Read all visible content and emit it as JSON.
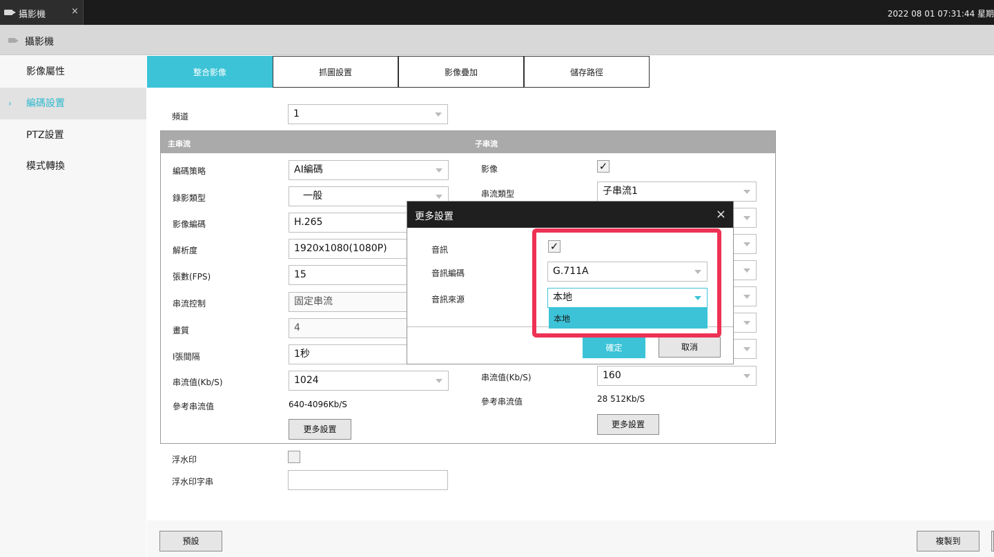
{
  "window": {
    "tab_title": "攝影機",
    "tab_close": "×",
    "datetime": "2022 08 01 07:31:44 星期"
  },
  "header": {
    "title": "攝影機"
  },
  "sidebar": {
    "items": [
      {
        "label": "影像屬性"
      },
      {
        "label": "編碼設置",
        "active": true,
        "chevron": "›"
      },
      {
        "label": "PTZ設置"
      },
      {
        "label": "模式轉換"
      }
    ]
  },
  "tabs": [
    {
      "label": "整合影像",
      "active": true
    },
    {
      "label": "抓圖設置"
    },
    {
      "label": "影像疊加"
    },
    {
      "label": "儲存路徑"
    }
  ],
  "channel": {
    "label": "頻道",
    "value": "1"
  },
  "main_stream": {
    "title": "主串流",
    "fields": {
      "encoding_strategy": {
        "label": "編碼策略",
        "value": "AI編碼"
      },
      "record_type": {
        "label": "錄影類型",
        "value": "一般"
      },
      "video_encoding": {
        "label": "影像編碼",
        "value": "H.265"
      },
      "resolution": {
        "label": "解析度",
        "value": "1920x1080(1080P)"
      },
      "fps": {
        "label": "張數(FPS)",
        "value": "15"
      },
      "bitrate_control": {
        "label": "串流控制",
        "value": "固定串流"
      },
      "quality": {
        "label": "畫質",
        "value": "4"
      },
      "iframe_interval": {
        "label": "I張間隔",
        "value": "1秒"
      },
      "bitrate": {
        "label": "串流值(Kb/S)",
        "value": "1024"
      },
      "ref_bitrate": {
        "label": "參考串流值",
        "value": "640-4096Kb/S"
      }
    },
    "more_button": "更多設置"
  },
  "sub_stream": {
    "title": "子串流",
    "video": {
      "label": "影像",
      "checked": true,
      "mark": "✓"
    },
    "stream_type": {
      "label": "串流類型",
      "value": "子串流1"
    },
    "bitrate": {
      "label": "串流值(Kb/S)",
      "value": "160"
    },
    "ref_bitrate": {
      "label": "參考串流值",
      "value": "28 512Kb/S"
    },
    "more_button": "更多設置"
  },
  "watermark": {
    "label": "浮水印",
    "checked": false
  },
  "watermark_text": {
    "label": "浮水印字串",
    "value": ""
  },
  "bottom": {
    "default_button": "預設",
    "copy_button": "複製到"
  },
  "modal": {
    "title": "更多設置",
    "close": "×",
    "audio": {
      "label": "音訊",
      "checked": true,
      "mark": "✓"
    },
    "audio_encoding": {
      "label": "音訊編碼",
      "value": "G.711A"
    },
    "audio_source": {
      "label": "音訊來源",
      "value": "本地"
    },
    "dropdown_options": [
      "本地"
    ],
    "ok": "確定",
    "cancel": "取消"
  },
  "colors": {
    "accent": "#3cc3d7",
    "highlight": "#ee3154"
  }
}
